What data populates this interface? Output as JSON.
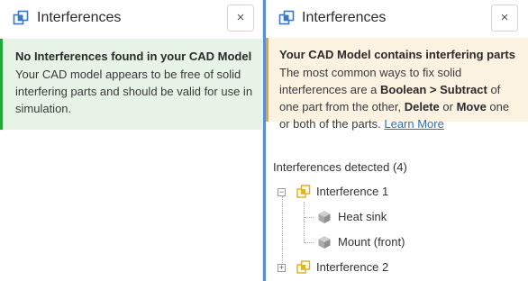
{
  "colors": {
    "accent_blue": "#5a8fd6",
    "success_border": "#22a83a",
    "success_bg": "#e6f3e6",
    "warning_border": "#dca733",
    "warning_bg": "#fbf2e2",
    "link": "#2f6fb3"
  },
  "left_panel": {
    "title": "Interferences",
    "header_icon": "interference-icon",
    "close_label": "×",
    "message": {
      "title": "No Interferences found in your CAD Model",
      "body": "Your CAD model appears to be free of solid interfering parts and should be valid for use in simulation."
    }
  },
  "right_panel": {
    "title": "Interferences",
    "header_icon": "interference-icon",
    "close_label": "×",
    "message": {
      "title": "Your CAD Model contains interfering parts",
      "body_part1": "The most common ways to fix solid interferences are a ",
      "bold1": "Boolean > Subtract",
      "body_part2": " of one part from the other, ",
      "bold2": "Delete",
      "body_part3": " or ",
      "bold3": "Move",
      "body_part4": " one or both of the parts. ",
      "link": "Learn More"
    },
    "section_title": "Interferences detected (4)",
    "tree": [
      {
        "label": "Interference 1",
        "expanded": true,
        "toggle": "−",
        "icon": "interference-icon",
        "children": [
          {
            "label": "Heat sink",
            "icon": "cube-icon"
          },
          {
            "label": "Mount (front)",
            "icon": "cube-icon"
          }
        ]
      },
      {
        "label": "Interference 2",
        "expanded": false,
        "toggle": "+",
        "icon": "interference-icon",
        "children": []
      }
    ]
  }
}
